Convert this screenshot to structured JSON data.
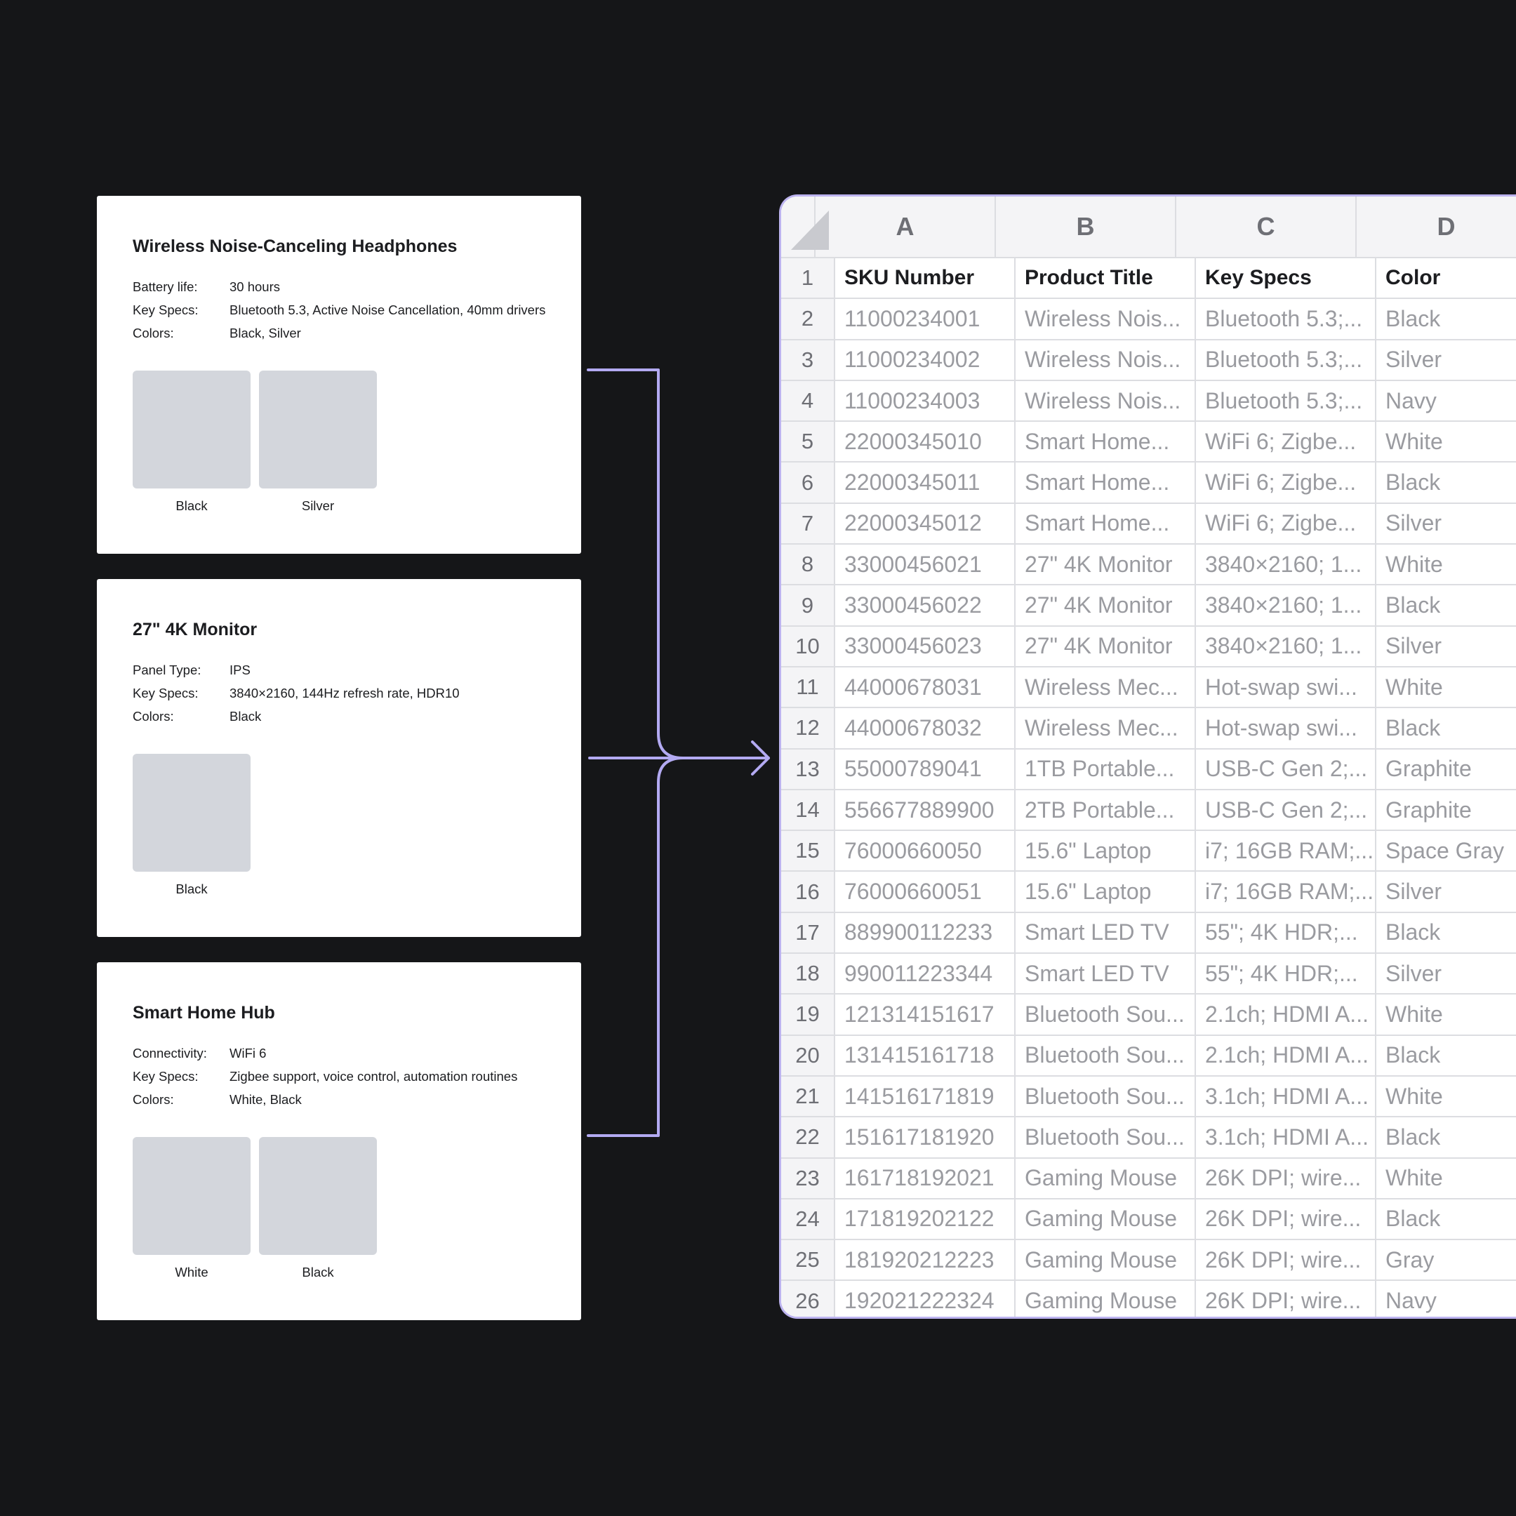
{
  "cards": [
    {
      "title": "Wireless Noise-Canceling Headphones",
      "specs": [
        {
          "label": "Battery life:",
          "value": "30 hours"
        },
        {
          "label": "Key Specs:",
          "value": "Bluetooth 5.3, Active Noise Cancellation, 40mm drivers"
        },
        {
          "label": "Colors:",
          "value": "Black, Silver"
        }
      ],
      "swatches": [
        "Black",
        "Silver"
      ]
    },
    {
      "title": "27\" 4K Monitor",
      "specs": [
        {
          "label": "Panel Type:",
          "value": "IPS"
        },
        {
          "label": "Key Specs:",
          "value": "3840×2160, 144Hz refresh rate, HDR10"
        },
        {
          "label": "Colors:",
          "value": "Black"
        }
      ],
      "swatches": [
        "Black"
      ]
    },
    {
      "title": "Smart Home Hub",
      "specs": [
        {
          "label": "Connectivity:",
          "value": "WiFi 6"
        },
        {
          "label": "Key Specs:",
          "value": "Zigbee support, voice control, automation routines"
        },
        {
          "label": "Colors:",
          "value": "White, Black"
        }
      ],
      "swatches": [
        "White",
        "Black"
      ]
    }
  ],
  "sheet": {
    "columns": [
      "A",
      "B",
      "C",
      "D"
    ],
    "header": [
      "SKU Number",
      "Product Title",
      "Key Specs",
      "Color"
    ],
    "rows": [
      [
        "11000234001",
        "Wireless Nois...",
        "Bluetooth 5.3;...",
        "Black"
      ],
      [
        "11000234002",
        "Wireless Nois...",
        "Bluetooth 5.3;...",
        "Silver"
      ],
      [
        "11000234003",
        "Wireless Nois...",
        "Bluetooth 5.3;...",
        "Navy"
      ],
      [
        "22000345010",
        "Smart Home...",
        "WiFi 6; Zigbe...",
        "White"
      ],
      [
        "22000345011",
        "Smart Home...",
        "WiFi 6; Zigbe...",
        "Black"
      ],
      [
        "22000345012",
        "Smart Home...",
        "WiFi 6; Zigbe...",
        "Silver"
      ],
      [
        "33000456021",
        "27\" 4K Monitor",
        "3840×2160; 1...",
        "White"
      ],
      [
        "33000456022",
        "27\" 4K Monitor",
        "3840×2160; 1...",
        "Black"
      ],
      [
        "33000456023",
        "27\" 4K Monitor",
        "3840×2160; 1...",
        "Silver"
      ],
      [
        "44000678031",
        "Wireless Mec...",
        "Hot-swap swi...",
        "White"
      ],
      [
        "44000678032",
        "Wireless Mec...",
        "Hot-swap swi...",
        "Black"
      ],
      [
        "55000789041",
        "1TB Portable...",
        "USB-C Gen 2;...",
        "Graphite"
      ],
      [
        "556677889900",
        "2TB Portable...",
        "USB-C Gen 2;...",
        "Graphite"
      ],
      [
        "76000660050",
        "15.6\" Laptop",
        "i7; 16GB RAM;...",
        "Space Gray"
      ],
      [
        "76000660051",
        "15.6\" Laptop",
        "i7; 16GB RAM;...",
        "Silver"
      ],
      [
        "889900112233",
        "Smart LED TV",
        "55\"; 4K HDR;...",
        "Black"
      ],
      [
        "990011223344",
        "Smart LED TV",
        "55\"; 4K HDR;...",
        "Silver"
      ],
      [
        "121314151617",
        "Bluetooth Sou...",
        "2.1ch; HDMI A...",
        "White"
      ],
      [
        "131415161718",
        "Bluetooth Sou...",
        "2.1ch; HDMI A...",
        "Black"
      ],
      [
        "141516171819",
        "Bluetooth Sou...",
        "3.1ch; HDMI A...",
        "White"
      ],
      [
        "151617181920",
        "Bluetooth Sou...",
        "3.1ch; HDMI A...",
        "Black"
      ],
      [
        "161718192021",
        "Gaming Mouse",
        "26K DPI; wire...",
        "White"
      ],
      [
        "171819202122",
        "Gaming Mouse",
        "26K DPI; wire...",
        "Black"
      ],
      [
        "181920212223",
        "Gaming Mouse",
        "26K DPI; wire...",
        "Gray"
      ],
      [
        "192021222324",
        "Gaming Mouse",
        "26K DPI; wire...",
        "Navy"
      ]
    ]
  },
  "colors": {
    "background": "#151618",
    "accent": "#b3aaf2",
    "swatch": "#d3d6dc"
  }
}
